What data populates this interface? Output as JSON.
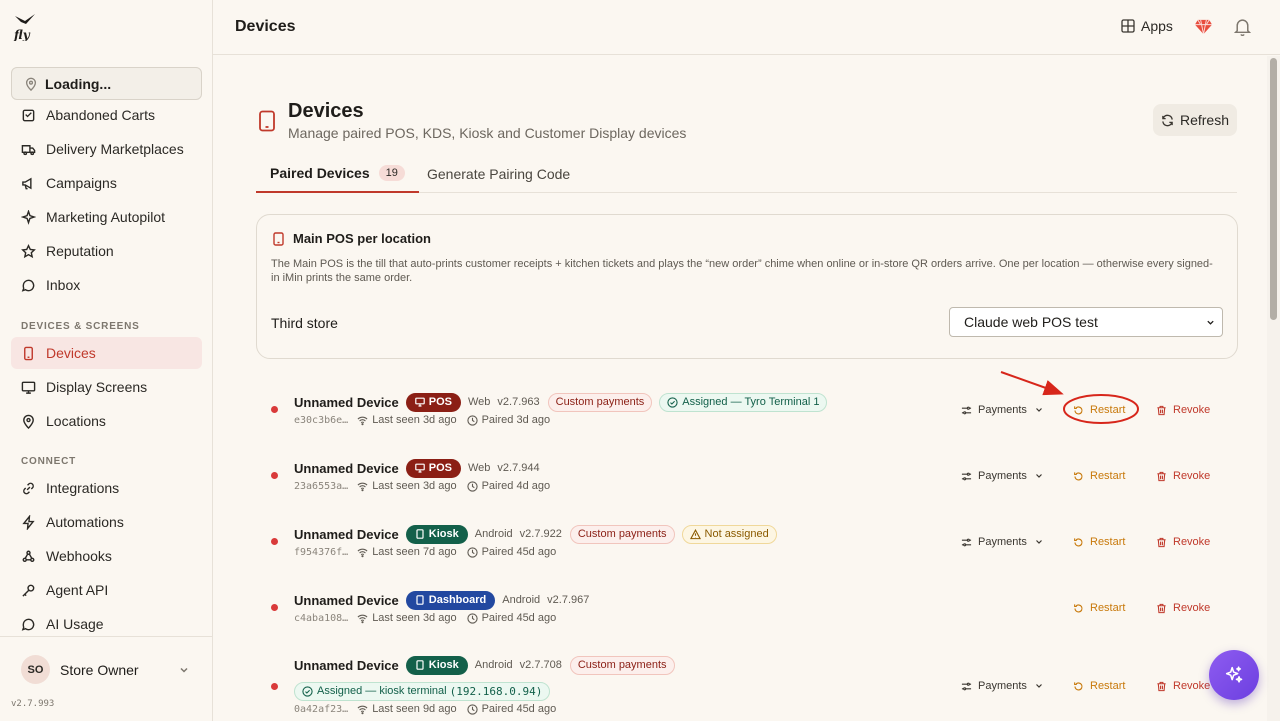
{
  "sidebar": {
    "location": "Loading...",
    "items_top": [
      {
        "label": "Abandoned Carts",
        "icon": "cart-icon"
      },
      {
        "label": "Delivery Marketplaces",
        "icon": "truck-icon"
      },
      {
        "label": "Campaigns",
        "icon": "megaphone-icon"
      },
      {
        "label": "Marketing Autopilot",
        "icon": "sparkle-icon"
      },
      {
        "label": "Reputation",
        "icon": "star-icon"
      },
      {
        "label": "Inbox",
        "icon": "chat-icon"
      }
    ],
    "section_devices": "DEVICES & SCREENS",
    "items_devices": [
      {
        "label": "Devices",
        "icon": "phone-icon",
        "active": true
      },
      {
        "label": "Display Screens",
        "icon": "monitor-icon"
      },
      {
        "label": "Locations",
        "icon": "pin-icon"
      }
    ],
    "section_connect": "CONNECT",
    "items_connect": [
      {
        "label": "Integrations",
        "icon": "link-icon"
      },
      {
        "label": "Automations",
        "icon": "bolt-icon"
      },
      {
        "label": "Webhooks",
        "icon": "webhook-icon"
      },
      {
        "label": "Agent API",
        "icon": "key-icon"
      },
      {
        "label": "AI Usage",
        "icon": "chat-icon"
      }
    ],
    "user": {
      "initials": "SO",
      "name": "Store Owner"
    },
    "version": "v2.7.993"
  },
  "topbar": {
    "title": "Devices",
    "apps_label": "Apps"
  },
  "page": {
    "title": "Devices",
    "subtitle": "Manage paired POS, KDS, Kiosk and Customer Display devices",
    "refresh_label": "Refresh",
    "tabs": [
      {
        "label": "Paired Devices",
        "count": "19",
        "active": true
      },
      {
        "label": "Generate Pairing Code"
      }
    ]
  },
  "main_pos_card": {
    "title": "Main POS per location",
    "description": "The Main POS is the till that auto-prints customer receipts + kitchen tickets and plays the “new order” chime when online or in-store QR orders arrive. One per location — otherwise every signed-in iMin prints the same order.",
    "store": "Third store",
    "selected_device": "Claude web POS test"
  },
  "actions": {
    "payments": "Payments",
    "restart": "Restart",
    "revoke": "Revoke"
  },
  "devices": [
    {
      "name": "Unnamed Device",
      "type": "POS",
      "platform": "Web",
      "version": "v2.7.963",
      "custom_payments": "Custom payments",
      "assignment": "Assigned — Tyro Terminal 1",
      "id": "e30c3b6e…",
      "last_seen": "Last seen 3d ago",
      "paired": "Paired 3d ago"
    },
    {
      "name": "Unnamed Device",
      "type": "POS",
      "platform": "Web",
      "version": "v2.7.944",
      "id": "23a6553a…",
      "last_seen": "Last seen 3d ago",
      "paired": "Paired 4d ago"
    },
    {
      "name": "Unnamed Device",
      "type": "Kiosk",
      "platform": "Android",
      "version": "v2.7.922",
      "custom_payments": "Custom payments",
      "warning": "Not assigned",
      "id": "f954376f…",
      "last_seen": "Last seen 7d ago",
      "paired": "Paired 45d ago"
    },
    {
      "name": "Unnamed Device",
      "type": "Dashboard",
      "platform": "Android",
      "version": "v2.7.967",
      "id": "c4aba108…",
      "last_seen": "Last seen 3d ago",
      "paired": "Paired 45d ago"
    },
    {
      "name": "Unnamed Device",
      "type": "Kiosk",
      "platform": "Android",
      "version": "v2.7.708",
      "custom_payments": "Custom payments",
      "assignment_prefix": "Assigned — kiosk terminal",
      "assignment_ip": "(192.168.0.94)",
      "id": "0a42af23…",
      "last_seen": "Last seen 9d ago",
      "paired": "Paired 45d ago"
    }
  ],
  "colors": {
    "accent": "#c0392b",
    "pos": "#8b1f15",
    "kiosk": "#13604a",
    "dashboard": "#2248a0",
    "restart": "#c8790b",
    "fab": "#7b4ce8"
  }
}
